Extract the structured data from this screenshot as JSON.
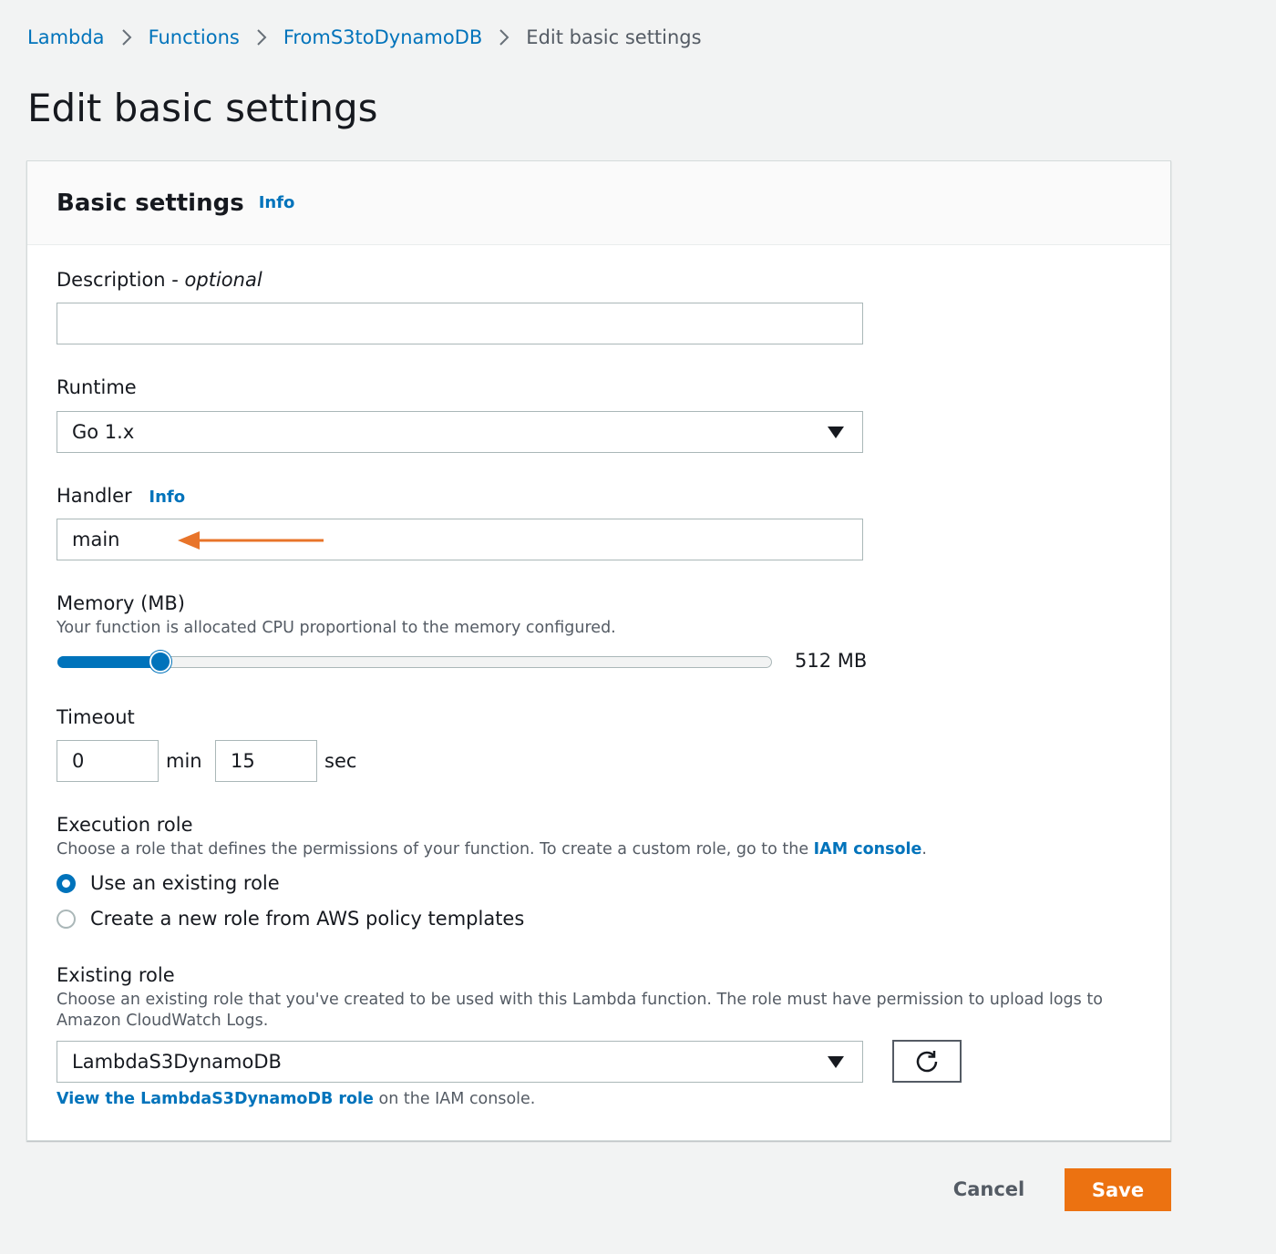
{
  "breadcrumb": {
    "items": [
      "Lambda",
      "Functions",
      "FromS3toDynamoDB"
    ],
    "current": "Edit basic settings"
  },
  "page_title": "Edit basic settings",
  "panel": {
    "title": "Basic settings",
    "info_link": "Info"
  },
  "description": {
    "label": "Description",
    "label_suffix": "optional",
    "value": "",
    "placeholder": ""
  },
  "runtime": {
    "label": "Runtime",
    "selected": "Go 1.x"
  },
  "handler": {
    "label": "Handler",
    "info_link": "Info",
    "value": "main",
    "annotation_arrow_color": "#e8742a"
  },
  "memory": {
    "label": "Memory (MB)",
    "description": "Your function is allocated CPU proportional to the memory configured.",
    "value_label": "512 MB",
    "slider_level": 0.145
  },
  "timeout": {
    "label": "Timeout",
    "minutes": "0",
    "minutes_unit": "min",
    "seconds": "15",
    "seconds_unit": "sec"
  },
  "execution_role": {
    "label": "Execution role",
    "description_prefix": "Choose a role that defines the permissions of your function. To create a custom role, go to the ",
    "description_link": "IAM console",
    "description_suffix": ".",
    "options": [
      {
        "label": "Use an existing role",
        "checked": true
      },
      {
        "label": "Create a new role from AWS policy templates",
        "checked": false
      }
    ]
  },
  "existing_role": {
    "label": "Existing role",
    "description": "Choose an existing role that you've created to be used with this Lambda function. The role must have permission to upload logs to Amazon CloudWatch Logs.",
    "selected": "LambdaS3DynamoDB",
    "view_link": "View the LambdaS3DynamoDB role",
    "view_suffix": " on the IAM console."
  },
  "footer": {
    "cancel_label": "Cancel",
    "save_label": "Save"
  },
  "colors": {
    "link": "#0073bb",
    "primary_button": "#ec7211",
    "page_background": "#f2f3f3"
  },
  "icons": [
    "chevron-right-icon",
    "dropdown-caret-icon",
    "refresh-icon",
    "arrow-left-icon"
  ]
}
